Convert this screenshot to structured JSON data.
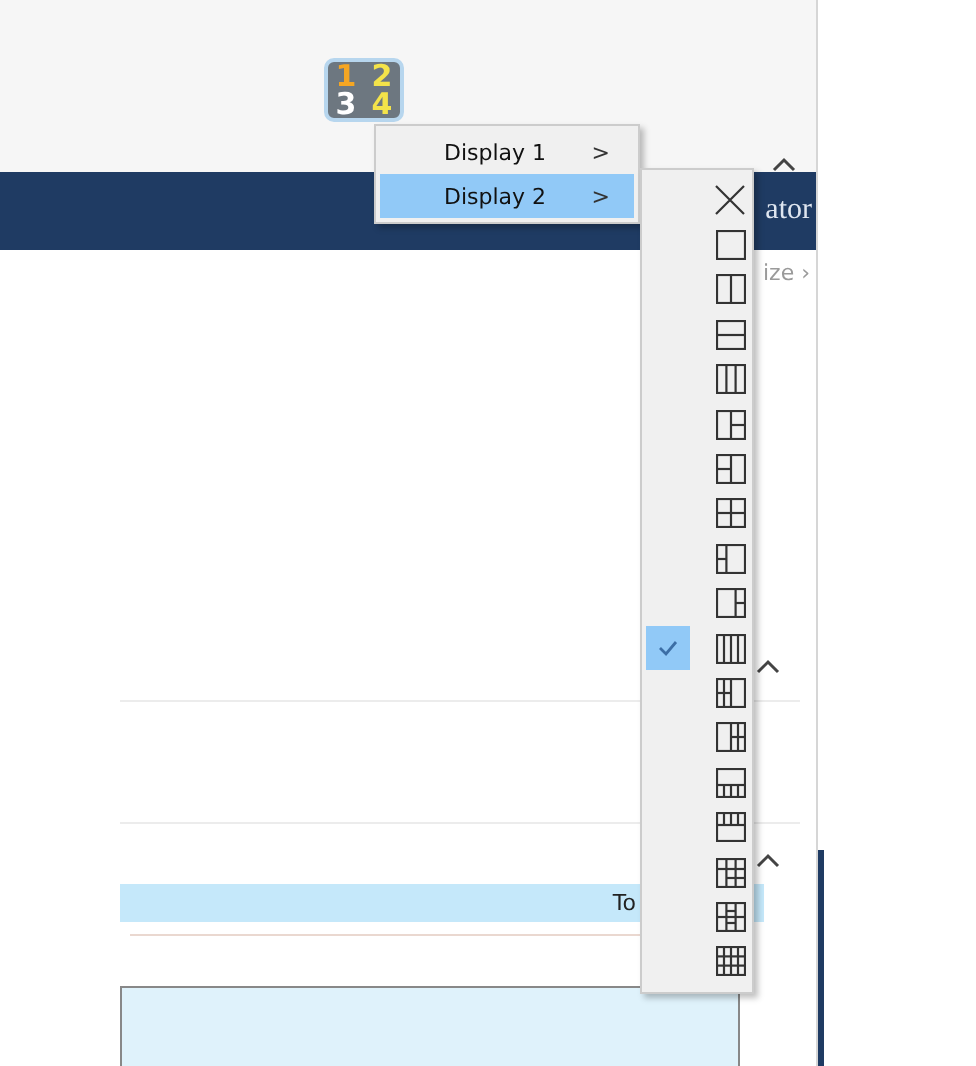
{
  "app_icon": {
    "tiles": [
      "1",
      "2",
      "3",
      "4"
    ]
  },
  "header": {
    "title_fragment": "ator",
    "link_fragment": "ize ›"
  },
  "display_menu": [
    {
      "label": "Display 1",
      "arrow": ">",
      "selected": false
    },
    {
      "label": "Display 2",
      "arrow": ">",
      "selected": true
    }
  ],
  "layout_menu": [
    {
      "kind": "close",
      "checked": false
    },
    {
      "kind": "layout",
      "checked": false
    },
    {
      "kind": "layout",
      "checked": false
    },
    {
      "kind": "layout",
      "checked": false
    },
    {
      "kind": "layout",
      "checked": false
    },
    {
      "kind": "layout",
      "checked": false
    },
    {
      "kind": "layout",
      "checked": false
    },
    {
      "kind": "layout",
      "checked": false
    },
    {
      "kind": "layout",
      "checked": false
    },
    {
      "kind": "layout",
      "checked": false
    },
    {
      "kind": "layout",
      "checked": true
    },
    {
      "kind": "layout",
      "checked": false
    },
    {
      "kind": "layout",
      "checked": false
    },
    {
      "kind": "layout",
      "checked": false
    },
    {
      "kind": "layout",
      "checked": false
    },
    {
      "kind": "layout",
      "checked": false
    },
    {
      "kind": "layout",
      "checked": false
    },
    {
      "kind": "layout",
      "checked": false
    }
  ],
  "table": {
    "header_fragment": "To"
  }
}
